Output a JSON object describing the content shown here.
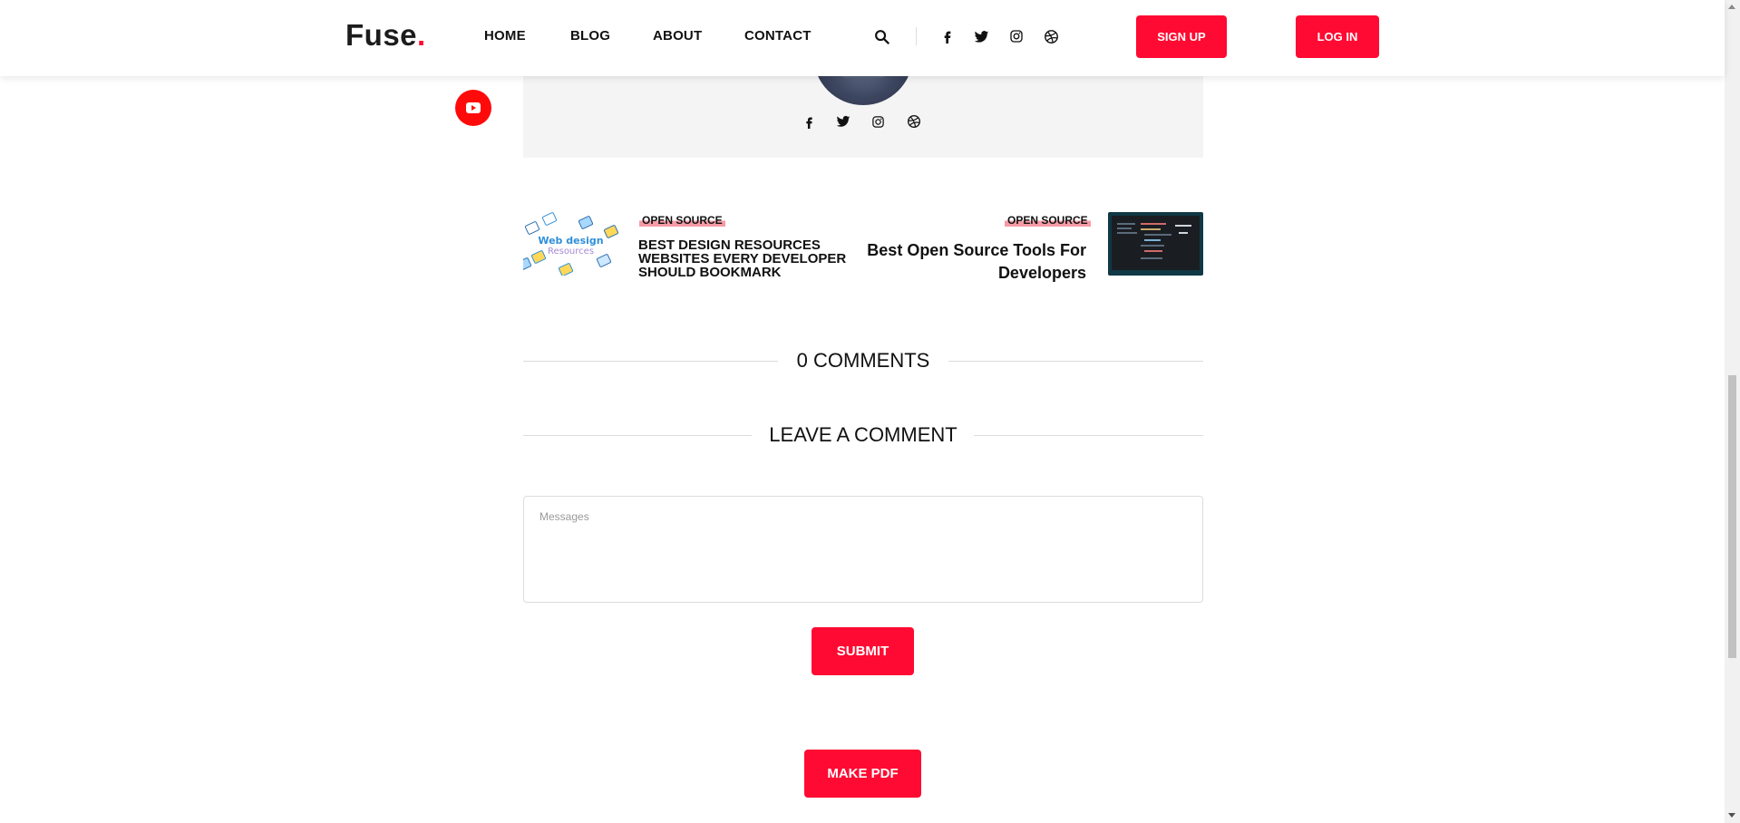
{
  "header": {
    "logo": "Fuse",
    "logo_dot": ".",
    "nav": [
      "HOME",
      "BLOG",
      "ABOUT",
      "CONTACT"
    ],
    "signup_label": "SIGN UP",
    "login_label": "LOG IN"
  },
  "related": {
    "left": {
      "tag": "OPEN SOURCE",
      "title": "BEST DESIGN RESOURCES WEBSITES EVERY DEVELOPER SHOULD BOOKMARK",
      "thumb_line1": "Web design",
      "thumb_line2": "Resources"
    },
    "right": {
      "tag": "OPEN SOURCE",
      "title": "Best Open Source Tools For Developers"
    }
  },
  "comments": {
    "count_heading": "0 COMMENTS",
    "leave_heading": "LEAVE A COMMENT",
    "message_placeholder": "Messages",
    "submit_label": "SUBMIT"
  },
  "make_pdf_label": "MAKE PDF",
  "colors": {
    "accent": "#ff0a32",
    "youtube": "#ff0a0a",
    "card_bg": "#f4f4f4"
  },
  "icons": [
    "search-icon",
    "facebook-icon",
    "twitter-icon",
    "instagram-icon",
    "dribbble-icon",
    "youtube-icon"
  ]
}
